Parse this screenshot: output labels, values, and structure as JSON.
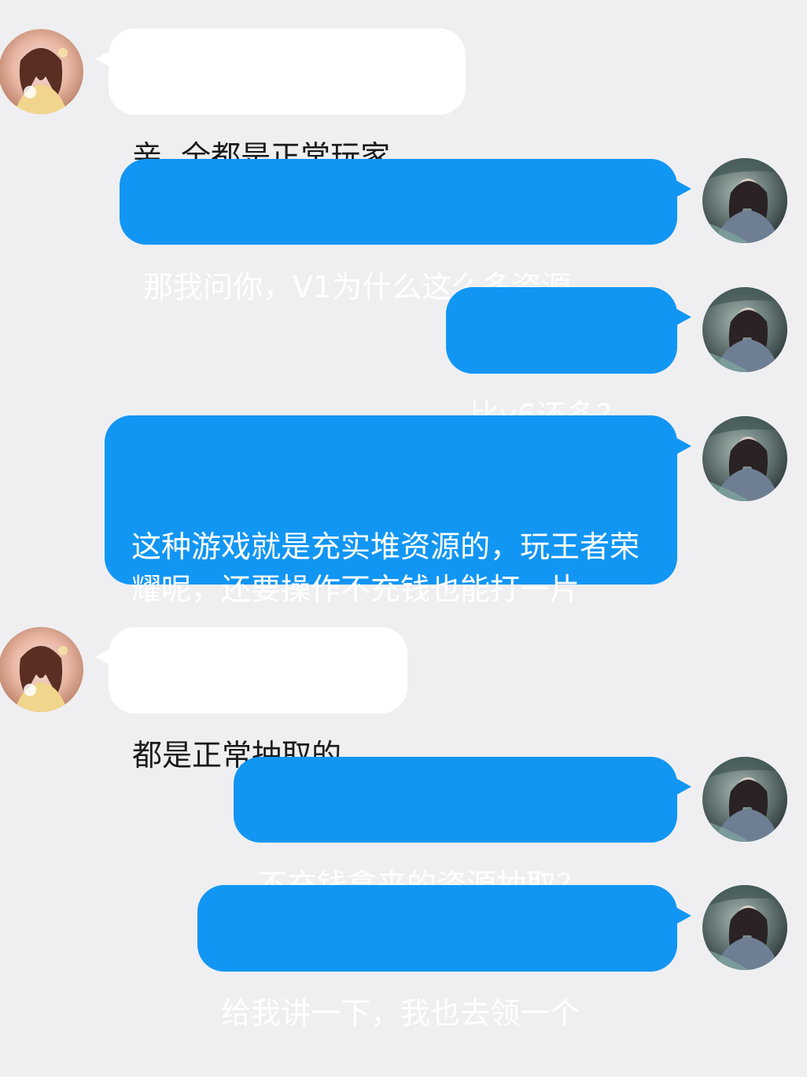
{
  "colors": {
    "background": "#efeff2",
    "incoming_bubble": "#ffffff",
    "outgoing_bubble": "#1296f3",
    "incoming_text": "#1a1a1a",
    "outgoing_text": "#ffffff"
  },
  "messages": [
    {
      "side": "incoming",
      "avatar": "contact-avatar",
      "text": "亲  全都是正常玩家"
    },
    {
      "side": "outgoing",
      "avatar": "self-avatar",
      "text": "那我问你，V1为什么这么多资源"
    },
    {
      "side": "outgoing",
      "avatar": "self-avatar",
      "text": "比v6还多？"
    },
    {
      "side": "outgoing",
      "avatar": "self-avatar",
      "text": "这种游戏就是充实堆资源的，玩王者荣耀呢，还要操作不充钱也能打一片"
    },
    {
      "side": "incoming",
      "avatar": "contact-avatar",
      "text": "都是正常抽取的"
    },
    {
      "side": "outgoing",
      "avatar": "self-avatar",
      "text": "不充钱拿来的资源抽取？"
    },
    {
      "side": "outgoing",
      "avatar": "self-avatar",
      "text": "给我讲一下，我也去领一个"
    }
  ]
}
